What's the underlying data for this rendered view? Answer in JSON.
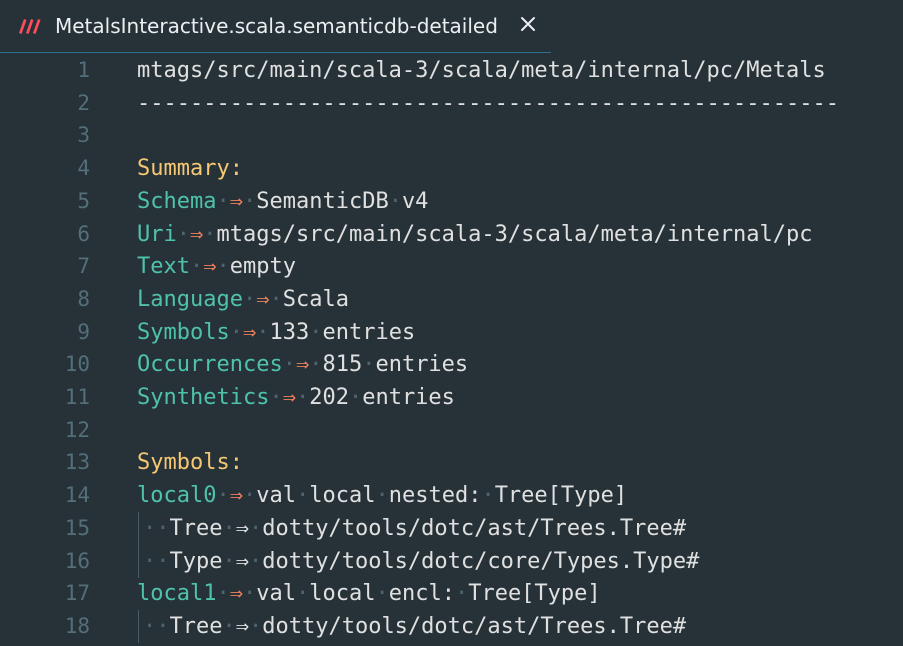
{
  "tab": {
    "title": "MetalsInteractive.scala.semanticdb-detailed",
    "icon": "metals-logo-icon",
    "close_icon": "close-icon"
  },
  "colors": {
    "background": "#263238",
    "heading": "#f7c873",
    "key": "#4fc3a8",
    "arrow": "#f0805c",
    "text": "#e0e0e0",
    "line_number": "#546e7a",
    "logo": "#ff4d5e"
  },
  "lines": [
    {
      "n": "1",
      "text": "mtags/src/main/scala-3/scala/meta/internal/pc/Metals"
    },
    {
      "n": "2",
      "text": "-----------------------------------------------------"
    },
    {
      "n": "3",
      "text": ""
    },
    {
      "n": "4",
      "heading": "Summary:"
    },
    {
      "n": "5",
      "key": "Schema",
      "value": "SemanticDB v4"
    },
    {
      "n": "6",
      "key": "Uri",
      "value": "mtags/src/main/scala-3/scala/meta/internal/pc"
    },
    {
      "n": "7",
      "key": "Text",
      "value": "empty"
    },
    {
      "n": "8",
      "key": "Language",
      "value": "Scala"
    },
    {
      "n": "9",
      "key": "Symbols",
      "value": "133 entries"
    },
    {
      "n": "10",
      "key": "Occurrences",
      "value": "815 entries"
    },
    {
      "n": "11",
      "key": "Synthetics",
      "value": "202 entries"
    },
    {
      "n": "12",
      "text": ""
    },
    {
      "n": "13",
      "heading": "Symbols:"
    },
    {
      "n": "14",
      "key": "local0",
      "value": "val local nested: Tree[Type]"
    },
    {
      "n": "15",
      "sub_key": "Tree",
      "value": "dotty/tools/dotc/ast/Trees.Tree#"
    },
    {
      "n": "16",
      "sub_key": "Type",
      "value": "dotty/tools/dotc/core/Types.Type#"
    },
    {
      "n": "17",
      "key": "local1",
      "value": "val local encl: Tree[Type]"
    },
    {
      "n": "18",
      "sub_key": "Tree",
      "value": "dotty/tools/dotc/ast/Trees.Tree#"
    }
  ],
  "arrow_glyph": "⇒"
}
